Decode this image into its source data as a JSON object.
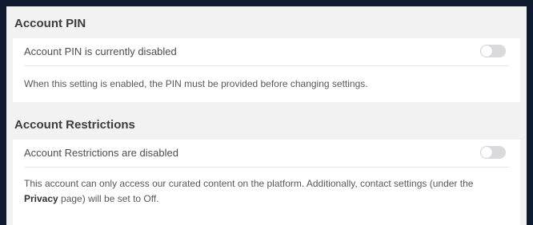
{
  "account_pin": {
    "title": "Account PIN",
    "toggle_label": "Account PIN is currently disabled",
    "toggle_on": false,
    "description": "When this setting is enabled, the PIN must be provided before changing settings."
  },
  "account_restrictions": {
    "title": "Account Restrictions",
    "toggle_label": "Account Restrictions are disabled",
    "toggle_on": false,
    "description_part1": "This account can only access our curated content on the platform. Additionally, contact settings (under the ",
    "privacy_link": "Privacy",
    "description_part2": " page) will be set to Off."
  },
  "colors": {
    "page_background": "#0e1a2e",
    "panel_background": "#f2f2f3",
    "toggle_off": "#d9dadd"
  }
}
